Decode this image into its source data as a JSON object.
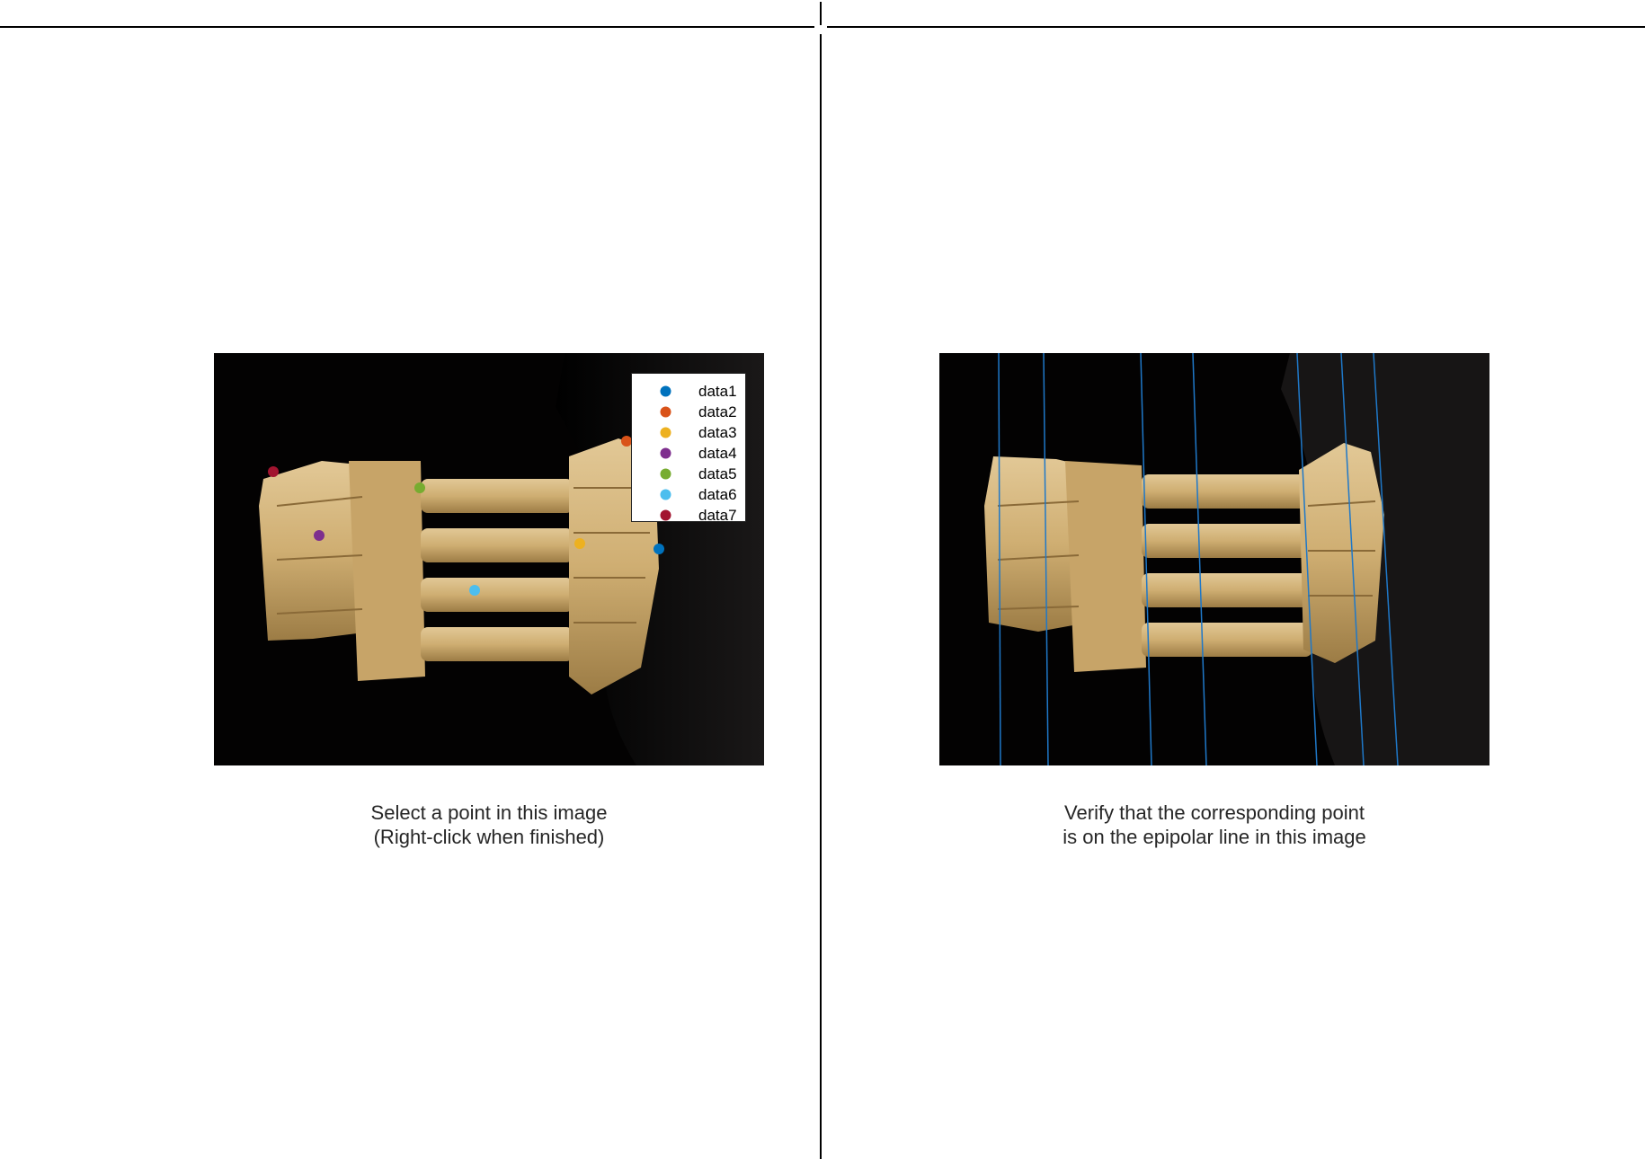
{
  "left_panel": {
    "caption_line1": "Select a point in this image",
    "caption_line2": "(Right-click when finished)"
  },
  "right_panel": {
    "caption_line1": "Verify that the corresponding point",
    "caption_line2": "is on the epipolar line in this image"
  },
  "legend": {
    "entries": [
      {
        "label": "data1",
        "color": "#0072BD"
      },
      {
        "label": "data2",
        "color": "#D95319"
      },
      {
        "label": "data3",
        "color": "#EDB120"
      },
      {
        "label": "data4",
        "color": "#7E2F8E"
      },
      {
        "label": "data5",
        "color": "#77AC30"
      },
      {
        "label": "data6",
        "color": "#4DBEEE"
      },
      {
        "label": "data7",
        "color": "#A2142F"
      }
    ]
  },
  "epipolar_line_color": "#1f78c8"
}
